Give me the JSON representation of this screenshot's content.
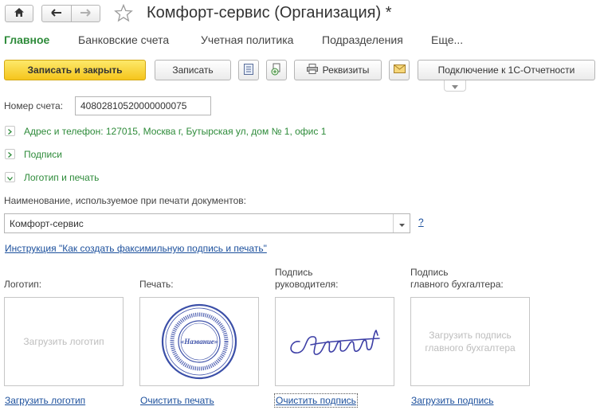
{
  "window": {
    "title": "Комфорт-сервис (Организация) *"
  },
  "tabs": [
    {
      "label": "Главное",
      "active": true
    },
    {
      "label": "Банковские счета"
    },
    {
      "label": "Учетная политика"
    },
    {
      "label": "Подразделения"
    },
    {
      "label": "Еще..."
    }
  ],
  "toolbar": {
    "save_close": "Записать и закрыть",
    "save": "Записать",
    "details": "Реквизиты",
    "connect": "Подключение к 1С-Отчетности"
  },
  "account": {
    "label": "Номер счета:",
    "value": "40802810520000000075"
  },
  "sections": {
    "address": "Адрес и телефон: 127015, Москва г, Бутырская ул, дом № 1, офис 1",
    "signatures": "Подписи",
    "logo_stamp": "Логотип и печать"
  },
  "print_name": {
    "label": "Наименование, используемое при печати документов:",
    "value": "Комфорт-сервис",
    "help": "?"
  },
  "instruction_link": "Инструкция \"Как создать факсимильную подпись и печать\"",
  "images": {
    "logo": {
      "title": "Логотип:",
      "placeholder": "Загрузить логотип",
      "action": "Загрузить логотип"
    },
    "stamp": {
      "title": "Печать:",
      "center_text": "«Название»",
      "action": "Очистить печать"
    },
    "head_sign": {
      "title_line1": "Подпись",
      "title_line2": "руководителя:",
      "action": "Очистить подпись"
    },
    "accountant_sign": {
      "title_line1": "Подпись",
      "title_line2": "главного бухгалтера:",
      "placeholder_line1": "Загрузить подпись",
      "placeholder_line2": "главного бухгалтера",
      "action": "Загрузить подпись"
    }
  },
  "colors": {
    "accent_green": "#2e8b3a",
    "link_blue": "#1b4f9c",
    "primary_yellow": "#f5c51c",
    "stamp_blue": "#3b4fa8"
  }
}
